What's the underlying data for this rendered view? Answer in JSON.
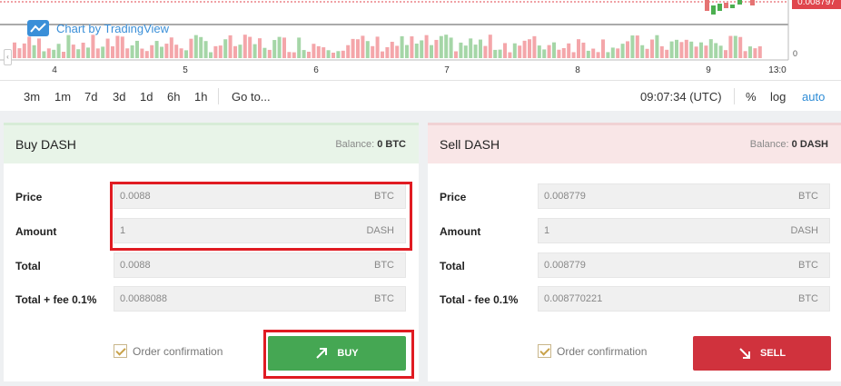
{
  "chart": {
    "watermark": "Chart by TradingView",
    "last_price": "0.008797",
    "volume_zero": "0",
    "x_ticks": [
      "4",
      "5",
      "6",
      "7",
      "8",
      "9",
      "13:0"
    ],
    "colors": {
      "up": "#4caf50",
      "down": "#e57373",
      "up_vol": "#a5d6a7",
      "down_vol": "#f4a6aa"
    }
  },
  "toolbar": {
    "timeframes": [
      "3m",
      "1m",
      "7d",
      "3d",
      "1d",
      "6h",
      "1h"
    ],
    "goto": "Go to...",
    "clock": "09:07:34 (UTC)",
    "percent": "%",
    "log": "log",
    "auto": "auto"
  },
  "buy": {
    "title": "Buy DASH",
    "balance_label": "Balance:",
    "balance_value": "0 BTC",
    "rows": [
      {
        "label": "Price",
        "value": "0.0088",
        "unit": "BTC"
      },
      {
        "label": "Amount",
        "value": "1",
        "unit": "DASH"
      },
      {
        "label": "Total",
        "value": "0.0088",
        "unit": "BTC"
      },
      {
        "label": "Total + fee 0.1%",
        "value": "0.0088088",
        "unit": "BTC"
      }
    ],
    "confirm_label": "Order confirmation",
    "button_label": "BUY",
    "color": "#45a753"
  },
  "sell": {
    "title": "Sell DASH",
    "balance_label": "Balance:",
    "balance_value": "0 DASH",
    "rows": [
      {
        "label": "Price",
        "value": "0.008779",
        "unit": "BTC"
      },
      {
        "label": "Amount",
        "value": "1",
        "unit": "DASH"
      },
      {
        "label": "Total",
        "value": "0.008779",
        "unit": "BTC"
      },
      {
        "label": "Total - fee 0.1%",
        "value": "0.008770221",
        "unit": "BTC"
      }
    ],
    "confirm_label": "Order confirmation",
    "button_label": "SELL",
    "color": "#d0323d"
  }
}
